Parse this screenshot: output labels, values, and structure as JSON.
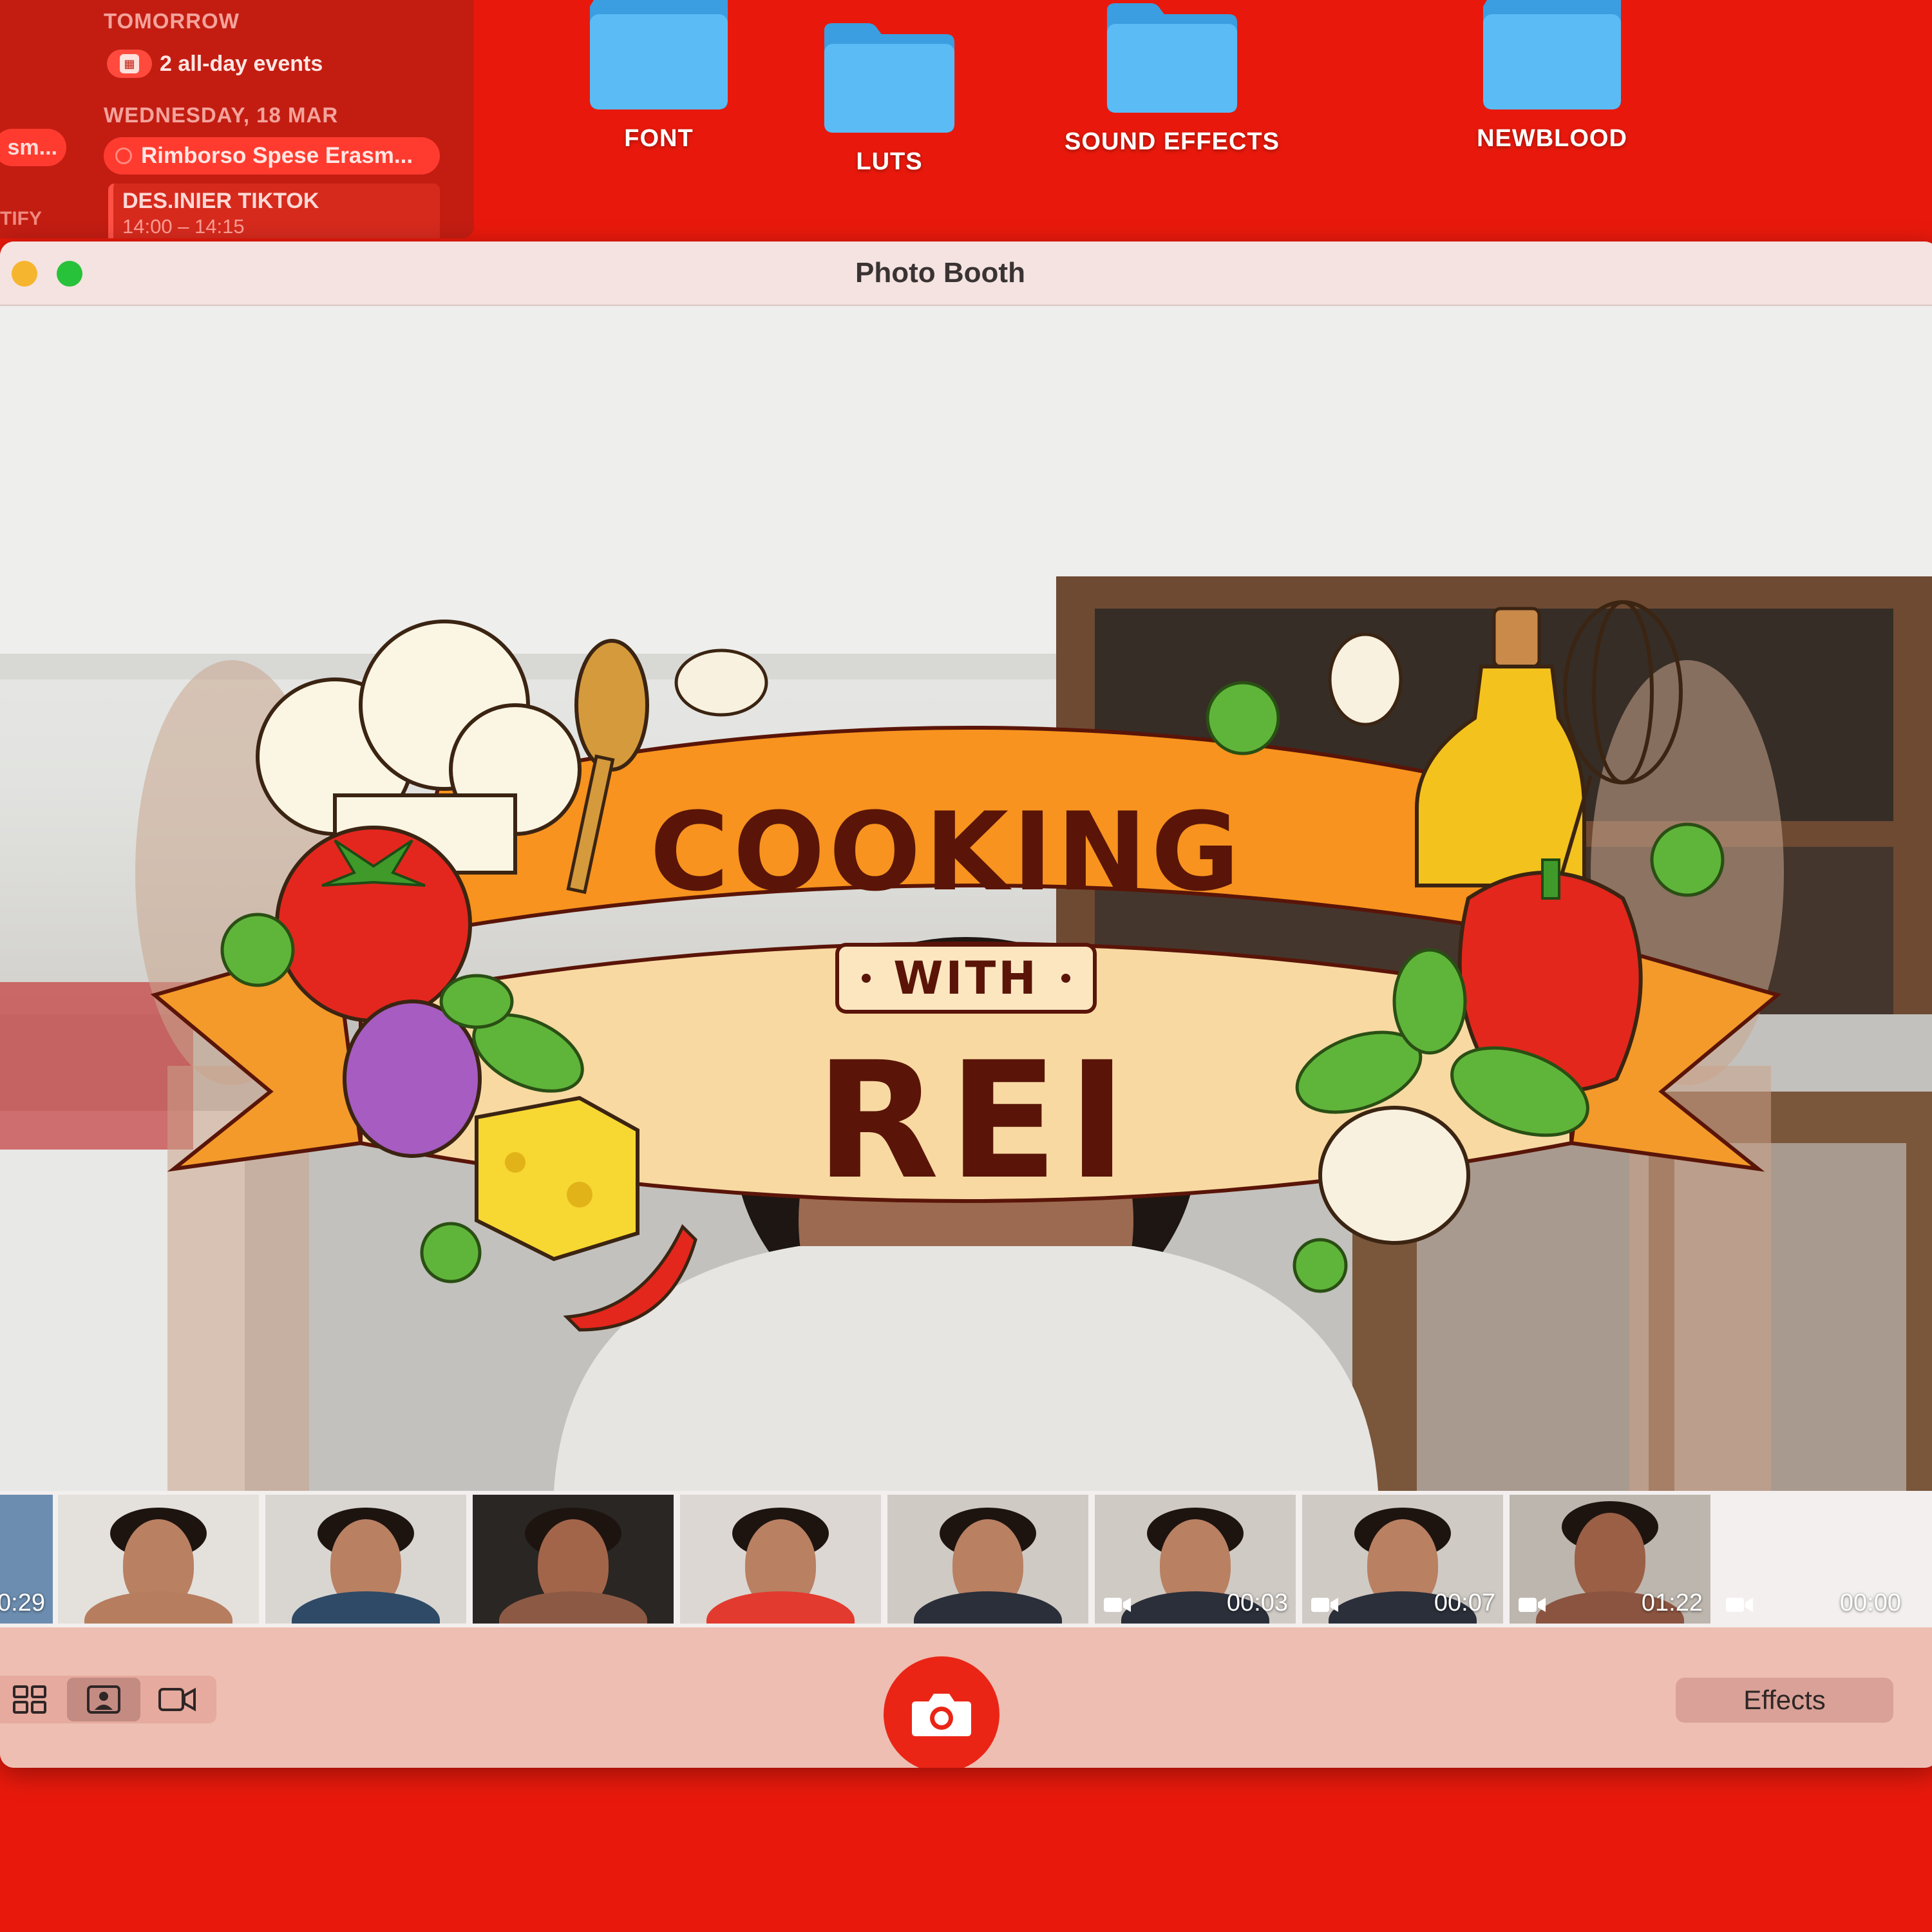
{
  "calendar": {
    "tomorrow_label": "TOMORROW",
    "all_day_events": "2 all-day events",
    "date_label": "WEDNESDAY, 18 MAR",
    "left_event": "sm...",
    "event_main": "Rimborso Spese Erasm...",
    "event_block_title": "DES.INIER TIKTOK",
    "event_block_time": "14:00 – 14:15",
    "side_label": "TIFY"
  },
  "desktop": {
    "folders": [
      {
        "label": "FONT",
        "icon": "folder-icon"
      },
      {
        "label": "LUTS",
        "icon": "folder-icon"
      },
      {
        "label": "SOUND EFFECTS",
        "icon": "folder-icon"
      },
      {
        "label": "NEWBLOOD",
        "icon": "folder-icon"
      }
    ]
  },
  "window": {
    "title": "Photo Booth",
    "traffic_lights": {
      "minimize": "#f6b52f",
      "zoom": "#27c13a"
    }
  },
  "overlay": {
    "line1": "COOKING",
    "line2": "WITH",
    "line3": "REI"
  },
  "thumbnails": [
    {
      "duration": "0:29",
      "is_video": false
    },
    {
      "duration": "",
      "is_video": false
    },
    {
      "duration": "",
      "is_video": false
    },
    {
      "duration": "",
      "is_video": false
    },
    {
      "duration": "",
      "is_video": false
    },
    {
      "duration": "",
      "is_video": false
    },
    {
      "duration": "00:03",
      "is_video": true
    },
    {
      "duration": "00:07",
      "is_video": true
    },
    {
      "duration": "01:22",
      "is_video": true
    },
    {
      "duration": "00:00",
      "is_video": true
    }
  ],
  "toolbar": {
    "modes": [
      "grid-view-icon",
      "photo-mode-icon",
      "video-mode-icon"
    ],
    "active_mode": "photo-mode-icon",
    "shutter_icon": "camera-icon",
    "effects_label": "Effects"
  },
  "colors": {
    "desktop_bg": "#e8190c",
    "folder_blue": "#5bbcf5",
    "shutter_red": "#ea2516",
    "banner_orange": "#f7931e",
    "banner_text": "#5a1508"
  }
}
